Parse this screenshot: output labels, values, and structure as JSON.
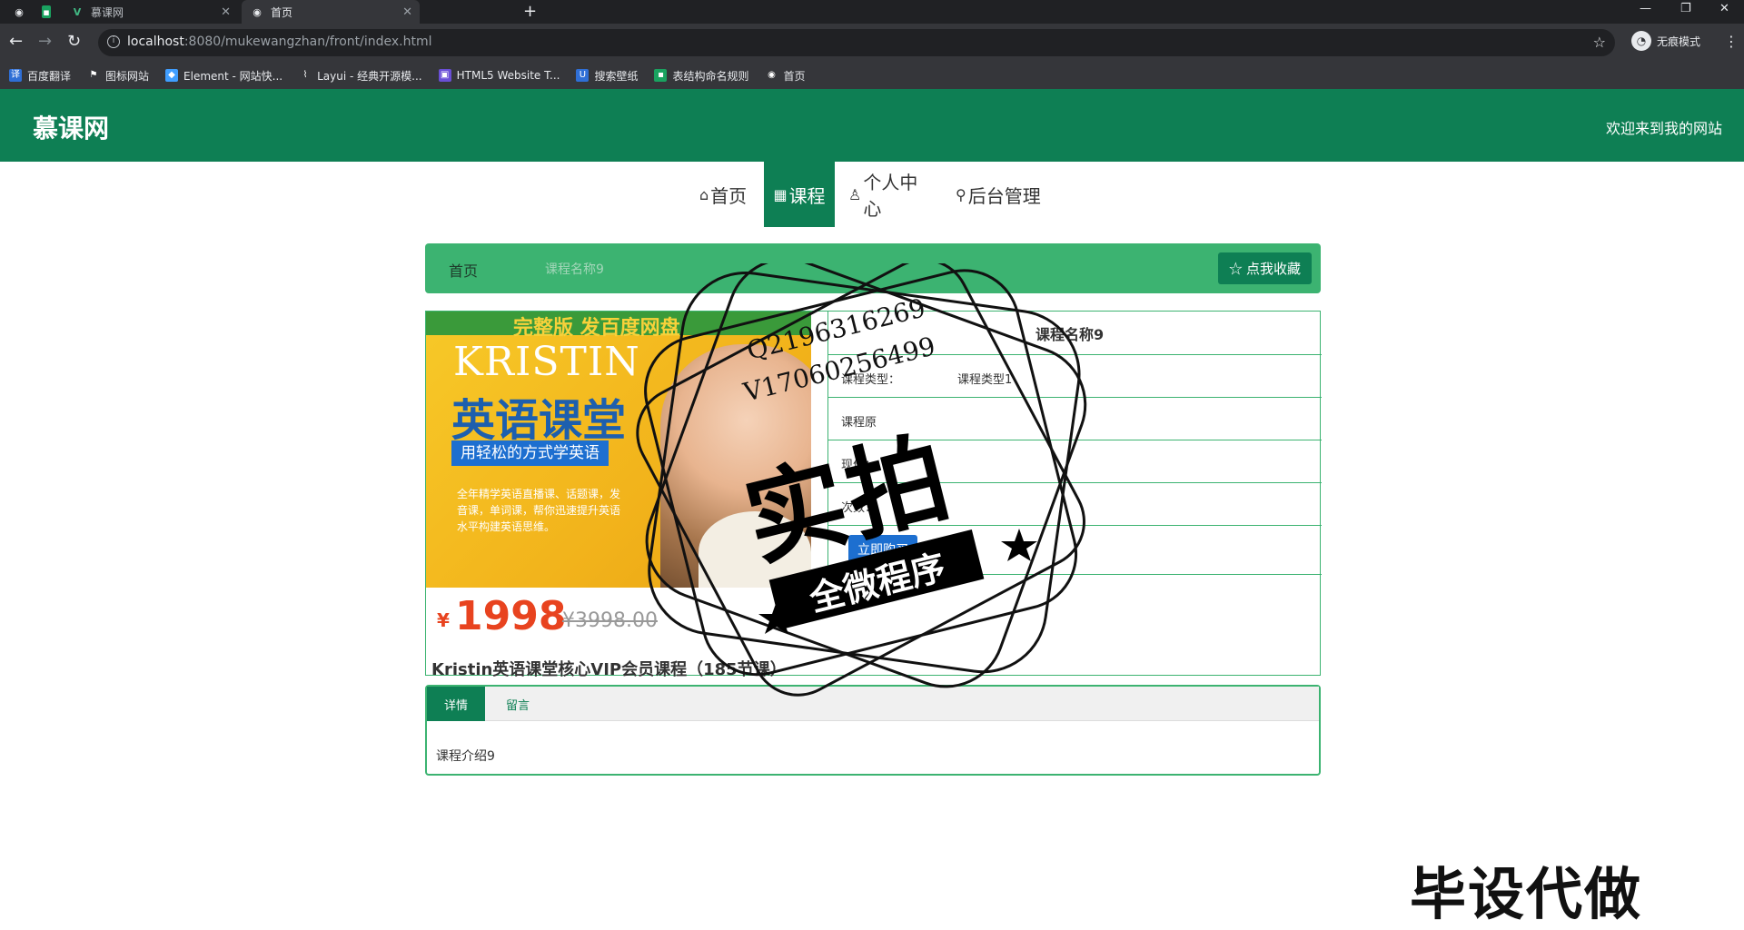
{
  "browser": {
    "tabs": [
      {
        "title": "",
        "icon": "spreadsheet-favicon"
      },
      {
        "title": "慕课网",
        "icon": "vue-favicon"
      },
      {
        "title": "首页",
        "icon": "globe-favicon"
      }
    ],
    "url_host": "localhost",
    "url_path": ":8080/mukewangzhan/front/index.html",
    "profile_label": "无痕模式",
    "bookmarks": [
      {
        "label": "百度翻译",
        "icon": "translate-icon",
        "color": "#2f6fd6"
      },
      {
        "label": "图标网站",
        "icon": "flag-icon",
        "color": "#35363a"
      },
      {
        "label": "Element - 网站快...",
        "icon": "element-icon",
        "color": "#409eff"
      },
      {
        "label": "Layui - 经典开源模...",
        "icon": "layui-icon",
        "color": "#35363a"
      },
      {
        "label": "HTML5 Website T...",
        "icon": "html5-icon",
        "color": "#6a4fd6"
      },
      {
        "label": "搜索壁纸",
        "icon": "wallpaper-icon",
        "color": "#2f6fd6"
      },
      {
        "label": "表结构命名规则",
        "icon": "sheet-icon",
        "color": "#1aa260"
      },
      {
        "label": "首页",
        "icon": "globe-icon",
        "color": "#35363a"
      }
    ]
  },
  "header": {
    "logo": "慕课网",
    "welcome": "欢迎来到我的网站"
  },
  "nav": [
    {
      "label": "首页",
      "icon": "⌂"
    },
    {
      "label": "课程",
      "icon": "▦"
    },
    {
      "label": "个人中心",
      "icon": "♙"
    },
    {
      "label": "后台管理",
      "icon": "⚲"
    }
  ],
  "breadcrumb": {
    "home": "首页",
    "current": "课程名称9",
    "favorite_label": "☆ 点我收藏"
  },
  "course": {
    "poster": {
      "top_banner": "完整版 发百度网盘",
      "brand": "KRISTIN",
      "title": "英语课堂",
      "slogan": "用轻松的方式学英语",
      "desc": "全年精学英语直播课、话题课，发音课，单词课，帮你迅速提升英语水平构建英语思维。",
      "price_symbol": "¥",
      "price": "1998",
      "original_price": "¥3998.00",
      "full_title": "Kristin英语课堂核心VIP会员课程（185节课）"
    },
    "name": "课程名称9",
    "type_label": "课程类型：",
    "type_value": "课程类型1",
    "fields": [
      {
        "label": "课程原"
      },
      {
        "label": "现价："
      },
      {
        "label": "次数："
      }
    ],
    "buy_label": "立即购买"
  },
  "tabs": {
    "items": [
      "详情",
      "留言"
    ],
    "content": "课程介绍9"
  },
  "overlay": {
    "stamp_q": "Q2196316269",
    "stamp_v": "V17060256499",
    "stamp_main": "实拍",
    "stamp_banner": "全微程序",
    "watermark": "毕设代做"
  }
}
